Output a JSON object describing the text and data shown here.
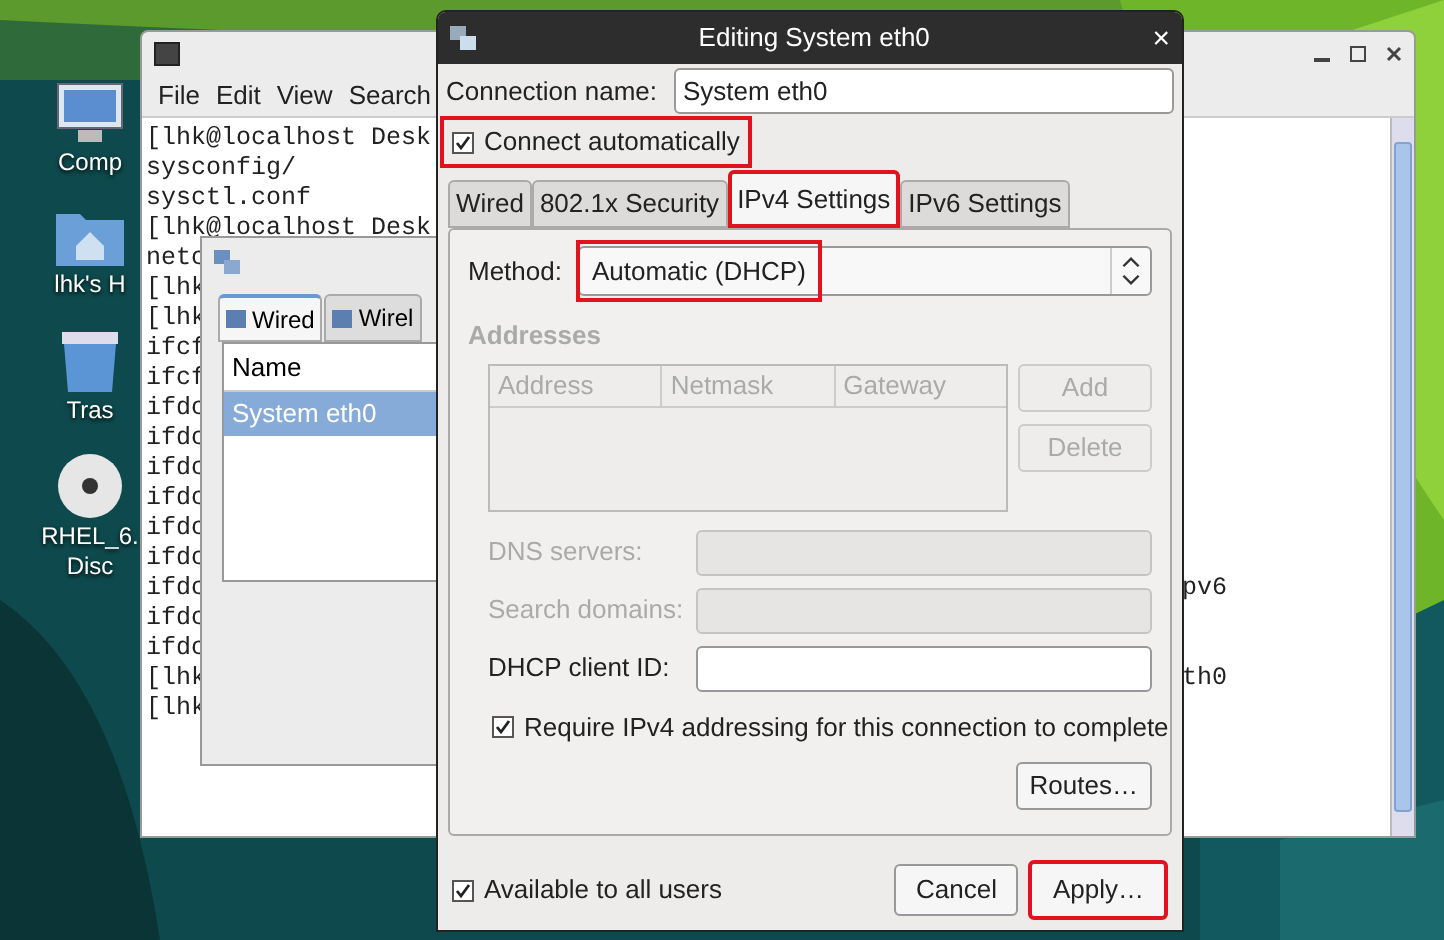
{
  "desktop_icons": [
    {
      "kind": "computer",
      "label": "Comp"
    },
    {
      "kind": "home",
      "label": "lhk's H"
    },
    {
      "kind": "trash",
      "label": "Tras"
    },
    {
      "kind": "disc",
      "label": "RHEL_6.",
      "label_2": "Disc"
    }
  ],
  "terminal": {
    "menu": [
      "File",
      "Edit",
      "View",
      "Search"
    ],
    "lines": [
      {
        "text": "[lhk@localhost Desk"
      },
      {
        "text": "sysconfig/"
      },
      {
        "text": "sysctl.conf"
      },
      {
        "text": "[lhk@localhost Desk"
      },
      {
        "text": "netc"
      },
      {
        "text": "[lhk"
      },
      {
        "text": "[lhk"
      },
      {
        "text": "ifcf"
      },
      {
        "text": "ifcf"
      },
      {
        "text": "ifdc"
      },
      {
        "text": "ifdc"
      },
      {
        "text": "ifdc"
      },
      {
        "text": "ifdc"
      },
      {
        "text": "ifdc"
      },
      {
        "text": "ifdc"
      },
      {
        "text": "ifdc",
        "tail": "pv6"
      },
      {
        "text": "ifdc"
      },
      {
        "text": "ifdc"
      },
      {
        "text": "[lhk",
        "tail": "th0"
      },
      {
        "text": "[lhk"
      }
    ]
  },
  "connections_window": {
    "tabs": [
      {
        "label": "Wired",
        "selected": true
      },
      {
        "label": "Wirel",
        "selected": false
      }
    ],
    "list": {
      "header": "Name",
      "rows": [
        {
          "label": "System eth0",
          "selected": true
        }
      ]
    }
  },
  "dialog": {
    "title": "Editing System eth0",
    "close": "×",
    "connection_name": {
      "label": "Connection name:",
      "value": "System eth0"
    },
    "connect_automatically": {
      "label": "Connect automatically",
      "checked": true,
      "highlighted": true
    },
    "tabs": [
      {
        "label": "Wired",
        "selected": false,
        "highlighted": false
      },
      {
        "label": "802.1x Security",
        "selected": false,
        "highlighted": false
      },
      {
        "label": "IPv4 Settings",
        "selected": true,
        "highlighted": true
      },
      {
        "label": "IPv6 Settings",
        "selected": false,
        "highlighted": false
      }
    ],
    "method": {
      "label": "Method:",
      "value": "Automatic (DHCP)",
      "highlighted": true
    },
    "addresses": {
      "heading": "Addresses",
      "columns": [
        "Address",
        "Netmask",
        "Gateway"
      ],
      "buttons": [
        {
          "label": "Add",
          "disabled": true
        },
        {
          "label": "Delete",
          "disabled": true
        }
      ]
    },
    "fields": [
      {
        "label": "DNS servers:",
        "disabled": true
      },
      {
        "label": "Search domains:",
        "disabled": true
      },
      {
        "label": "DHCP client ID:",
        "disabled": false
      }
    ],
    "require_ipv4": {
      "label": "Require IPv4 addressing for this connection to complete",
      "checked": true
    },
    "routes_button": "Routes…",
    "available_to_all": {
      "label": "Available to all users",
      "checked": true
    },
    "buttons": [
      {
        "label": "Cancel",
        "highlighted": false
      },
      {
        "label": "Apply…",
        "highlighted": true
      }
    ]
  }
}
